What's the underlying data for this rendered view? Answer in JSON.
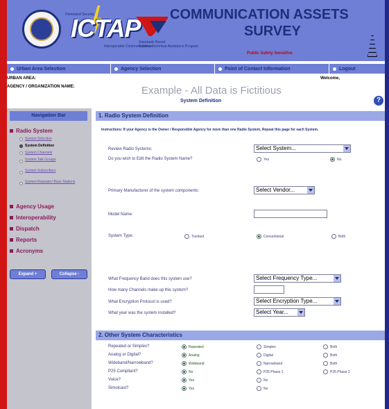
{
  "banner": {
    "dept_text": "Homeland Security",
    "logo_text": "ICTAP",
    "logo_tagline": "Interoperable Communications Technical Assistance Program",
    "partner_text": "Standards Based Solutions",
    "title_line1": "COMMUNICATION ASSETS",
    "title_line2": "SURVEY",
    "sensitivity": "Public Safety Sensitive"
  },
  "topnav": [
    {
      "label": "Urban Area Selection"
    },
    {
      "label": "Agency Selection"
    },
    {
      "label": "Point of Contact Information"
    },
    {
      "label": "Logout"
    }
  ],
  "info": {
    "urban_area_label": "URBAN AREA:",
    "agency_label": "AGENCY / ORGANIZATION NAME:",
    "welcome": "Welcome,",
    "example": "Example - All Data is Fictitious",
    "section_title": "System Definition",
    "help": "?"
  },
  "sidebar": {
    "header": "Navigation Bar",
    "radio_system": "Radio System",
    "sub_items": [
      {
        "label": "System Selection",
        "active": false
      },
      {
        "label": "System Definition",
        "active": true
      },
      {
        "label": "System Channels",
        "active": false
      },
      {
        "label": "System Talk Groups",
        "active": false
      },
      {
        "label": "System Subscribers",
        "active": false
      },
      {
        "label": "System Repeater/ Base Stations",
        "active": false
      }
    ],
    "agency_usage": "Agency Usage",
    "interoperability": "Interoperability",
    "dispatch": "Dispatch",
    "reports": "Reports",
    "acronyms": "Acronyms",
    "expand": "Expand +",
    "collapse": "Collapse -"
  },
  "section1": {
    "title": "1. Radio System Definition",
    "instructions": "Instructions: If your Agency is the Owner / Responsible Agency for more than one Radio System, Repeat this page for each System.",
    "system_label": "Review Radio Systems:",
    "system_value": "Select System...",
    "edit_label": "Do you wish to Edit the Radio System Name?",
    "edit_yes": "Yes",
    "edit_no": "No",
    "vendor_label": "Primary Manufacturer of the system components:",
    "vendor_value": "Select Vendor...",
    "model_label": "Model Name:",
    "model_value": "",
    "type_label": "System Type:",
    "type_trunked": "Trunked",
    "type_conventional": "Conventional",
    "type_both": "Both",
    "freq_label": "What Frequency Band does this system use?",
    "freq_value": "Select Frequency Type...",
    "channels_label": "How many Channels make up this system?",
    "channels_value": "",
    "encryption_label": "What Encryption Protocol is used?",
    "encryption_value": "Select Encryption Type...",
    "year_label": "What year was the system installed?",
    "year_value": "Select Year..."
  },
  "section2": {
    "title": "2. Other System Characteristics",
    "rows": [
      {
        "label": "Repeated or Simplex?",
        "opt1": "Repeated",
        "opt2": "Simplex",
        "opt3": "Both"
      },
      {
        "label": "Analog or Digital?",
        "opt1": "Analog",
        "opt2": "Digital",
        "opt3": "Both"
      },
      {
        "label": "Wideband/Narrowband?",
        "opt1": "Wideband",
        "opt2": "Narrowband",
        "opt3": "Both"
      },
      {
        "label": "P25 Compliant?",
        "opt1": "No",
        "opt2": "P25 Phase 1",
        "opt3": "P25 Phase 2"
      },
      {
        "label": "Voice?",
        "opt1": "Yes",
        "opt2": "No",
        "opt3": ""
      },
      {
        "label": "Simulcast?",
        "opt1": "Yes",
        "opt2": "No",
        "opt3": ""
      }
    ]
  },
  "colors": {
    "banner": "#6f7fd6",
    "dark_blue": "#1d2f7a",
    "accent_red": "#d11414",
    "nav_link": "#8b1a5a"
  }
}
